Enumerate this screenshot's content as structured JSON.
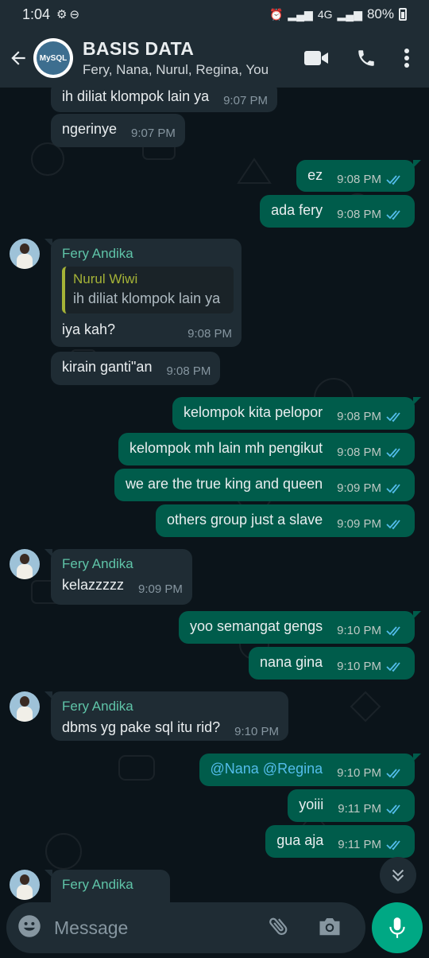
{
  "status_bar": {
    "time": "1:04",
    "network": "4G",
    "battery_percent": "80%"
  },
  "header": {
    "group_title": "BASIS DATA",
    "members": "Fery, Nana, Nurul, Regina, You",
    "group_avatar_text": "MySQL"
  },
  "messages": [
    {
      "dir": "in",
      "text": "ih diliat klompok lain ya",
      "time": "9:07 PM"
    },
    {
      "dir": "in",
      "text": "ngerinye",
      "time": "9:07 PM"
    },
    {
      "dir": "out",
      "text": "ez",
      "time": "9:08 PM"
    },
    {
      "dir": "out",
      "text": "ada fery",
      "time": "9:08 PM"
    },
    {
      "dir": "in",
      "sender": "Fery Andika",
      "quote_sender": "Nurul Wiwi",
      "quote_text": "ih diliat klompok lain ya",
      "text": "iya kah?",
      "time": "9:08 PM"
    },
    {
      "dir": "in",
      "text": "kirain ganti\"an",
      "time": "9:08 PM"
    },
    {
      "dir": "out",
      "text": "kelompok kita pelopor",
      "time": "9:08 PM"
    },
    {
      "dir": "out",
      "text": "kelompok mh lain mh pengikut",
      "time": "9:08 PM"
    },
    {
      "dir": "out",
      "text": "we are the true king and queen",
      "time": "9:09 PM"
    },
    {
      "dir": "out",
      "text": "others group just a slave",
      "time": "9:09 PM"
    },
    {
      "dir": "in",
      "sender": "Fery Andika",
      "text": "kelazzzzz",
      "time": "9:09 PM"
    },
    {
      "dir": "out",
      "text": "yoo semangat gengs",
      "time": "9:10 PM"
    },
    {
      "dir": "out",
      "text": "nana gina",
      "time": "9:10 PM"
    },
    {
      "dir": "in",
      "sender": "Fery Andika",
      "text": "dbms yg pake sql itu rid?",
      "time": "9:10 PM"
    },
    {
      "dir": "out",
      "text": "@Nana @Regina",
      "time": "9:10 PM"
    },
    {
      "dir": "out",
      "text": "yoiii",
      "time": "9:11 PM"
    },
    {
      "dir": "out",
      "text": "gua aja",
      "time": "9:11 PM"
    },
    {
      "dir": "in",
      "sender": "Fery Andika"
    }
  ],
  "composer": {
    "placeholder": "Message"
  },
  "colors": {
    "incoming": "#1f2c34",
    "outgoing": "#005c4b",
    "accent": "#00a884",
    "read_ticks": "#53bdeb"
  }
}
